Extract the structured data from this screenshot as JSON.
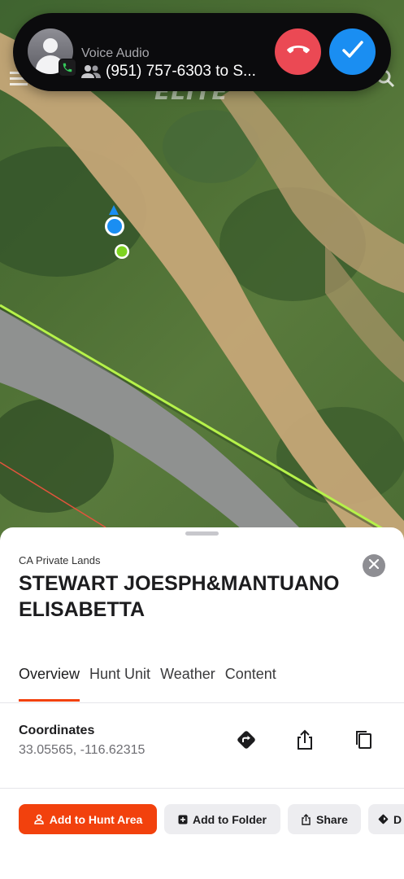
{
  "call": {
    "type": "Voice Audio",
    "number": "(951) 757-6303 to S...",
    "decline_icon": "phone-down-icon",
    "accept_icon": "checkmark-icon",
    "colors": {
      "decline": "#eb4954",
      "accept": "#1a8ef2",
      "banner": "#0b0b0d"
    }
  },
  "map": {
    "label": "ELITE",
    "icons": [
      "menu-icon",
      "search-icon",
      "heading-arrow-icon",
      "user-location-dot",
      "gps-point-dot"
    ],
    "colors": {
      "boundary": "#b6f24a",
      "road": "#8f9190",
      "path": "#c9a879",
      "user_location": "#1a8ef2",
      "gps_point": "#7ed321"
    }
  },
  "sheet": {
    "layer": "CA Private Lands",
    "title": "STEWART JOESPH&MANTUANO ELISABETTA",
    "tabs": [
      {
        "label": "Overview",
        "active": true
      },
      {
        "label": "Hunt Unit",
        "active": false
      },
      {
        "label": "Weather",
        "active": false
      },
      {
        "label": "Content",
        "active": false
      }
    ],
    "coordinates": {
      "label": "Coordinates",
      "value": "33.05565, -116.62315"
    },
    "actions": {
      "add_hunt_area": "Add to Hunt Area",
      "add_folder": "Add to Folder",
      "share": "Share",
      "more": "D"
    },
    "accent": "#f2410d"
  }
}
